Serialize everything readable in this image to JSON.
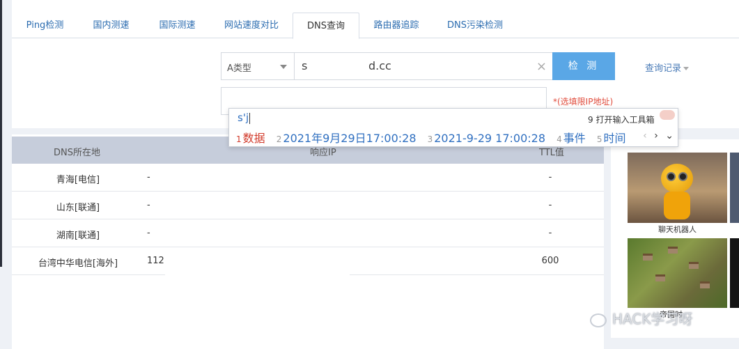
{
  "tabs": [
    "Ping检测",
    "国内测速",
    "国际测速",
    "网站速度对比",
    "DNS查询",
    "路由器追踪",
    "DNS污染检测"
  ],
  "active_tab": "DNS查询",
  "query": {
    "type_select": "A类型",
    "domain_value_prefix": "s",
    "domain_value_suffix": "d.cc",
    "clear_icon": "×",
    "check_button": "检 测",
    "history_link": "查询记录",
    "ip_input_value": "",
    "ip_hint": "*(选填限IP地址)"
  },
  "ime": {
    "composition": "s'j",
    "toolbox": "9 打开输入工具箱",
    "candidates": [
      {
        "num": "1",
        "text": "数据"
      },
      {
        "num": "2",
        "text": "2021年9月29日17:00:28"
      },
      {
        "num": "3",
        "text": "2021-9-29 17:00:28"
      },
      {
        "num": "4",
        "text": "事件"
      },
      {
        "num": "5",
        "text": "时间"
      }
    ],
    "nav_prev": "‹",
    "nav_next": "›",
    "nav_expand": "⌄"
  },
  "table": {
    "headers": [
      "DNS所在地",
      "响应IP",
      "TTL值"
    ],
    "rows": [
      {
        "location": "青海[电信]",
        "ip": "-",
        "ttl": "-"
      },
      {
        "location": "山东[联通]",
        "ip": "-",
        "ttl": "-"
      },
      {
        "location": "湖南[联通]",
        "ip": "-",
        "ttl": "-"
      },
      {
        "location": "台湾中华电信[海外]",
        "ip": "112.",
        "ttl": "600"
      }
    ]
  },
  "sidebar": {
    "caption1": "聊天机器人",
    "caption2": "帝国时"
  },
  "watermark": "HACK学习呀",
  "colors": {
    "accent": "#5aa7e6",
    "link": "#2b6cb0",
    "hint": "#e04a3a",
    "header_bg": "#c6cddb"
  }
}
